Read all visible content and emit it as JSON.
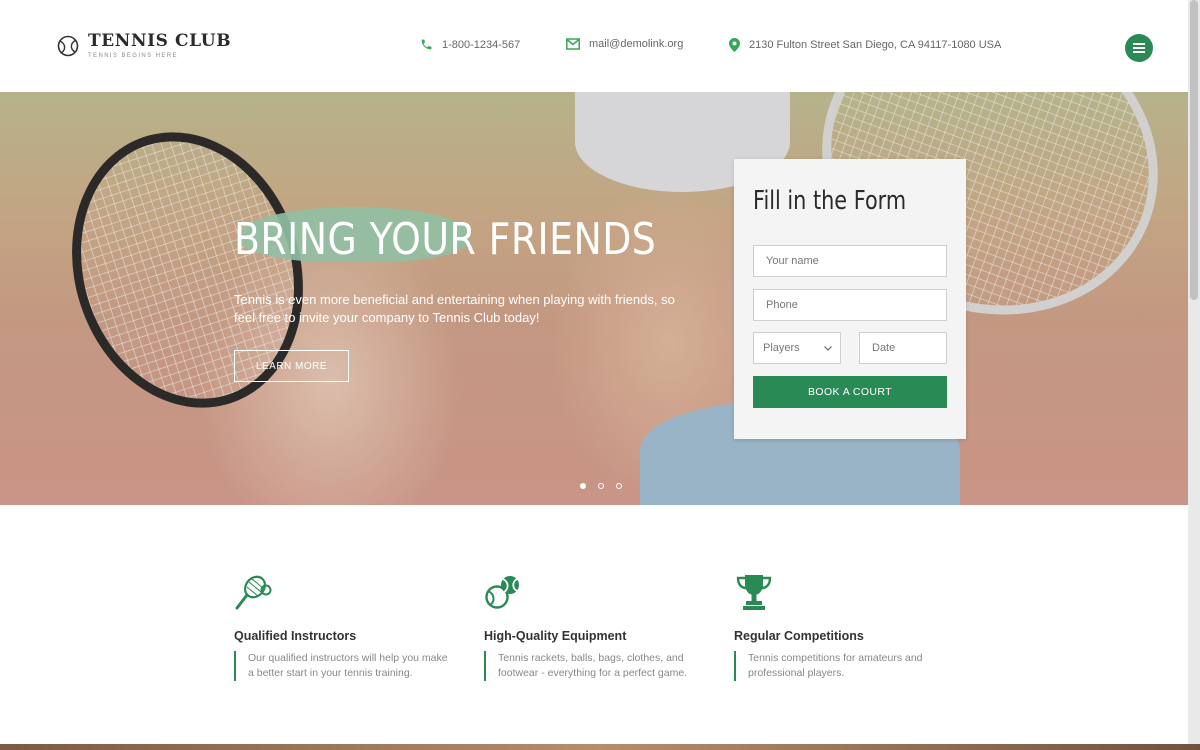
{
  "colors": {
    "accent": "#2a8a55",
    "icon_green": "#3aa65a"
  },
  "brand": {
    "title": "TENNIS CLUB",
    "tagline": "TENNIS BEGINS HERE",
    "icon": "tennis-ball-icon"
  },
  "contacts": [
    {
      "icon": "phone-icon",
      "text": "1-800-1234-567"
    },
    {
      "icon": "mail-icon",
      "text": "mail@demolink.org"
    },
    {
      "icon": "map-pin-icon",
      "text": "2130 Fulton Street San Diego, CA 94117-1080 USA"
    }
  ],
  "menu": {
    "icon": "hamburger-menu-icon"
  },
  "hero": {
    "title": "BRING YOUR FRIENDS",
    "text": "Tennis is even more beneficial and entertaining when playing with friends, so feel free to invite your company to Tennis Club today!",
    "button": "LEARN MORE",
    "slides_total": 3,
    "slide_active": 1
  },
  "form": {
    "title": "Fill in the Form",
    "name_placeholder": "Your name",
    "phone_placeholder": "Phone",
    "players_selected": "Players",
    "date_placeholder": "Date",
    "submit": "BOOK A COURT"
  },
  "features": [
    {
      "icon": "racket-and-ball-icon",
      "title": "Qualified Instructors",
      "text": "Our qualified instructors will help you make a better start in your tennis training."
    },
    {
      "icon": "tennis-balls-icon",
      "title": "High-Quality Equipment",
      "text": "Tennis rackets, balls, bags, clothes, and footwear - everything for a perfect game."
    },
    {
      "icon": "trophy-icon",
      "title": "Regular Competitions",
      "text": "Tennis competitions for amateurs and professional players."
    }
  ]
}
